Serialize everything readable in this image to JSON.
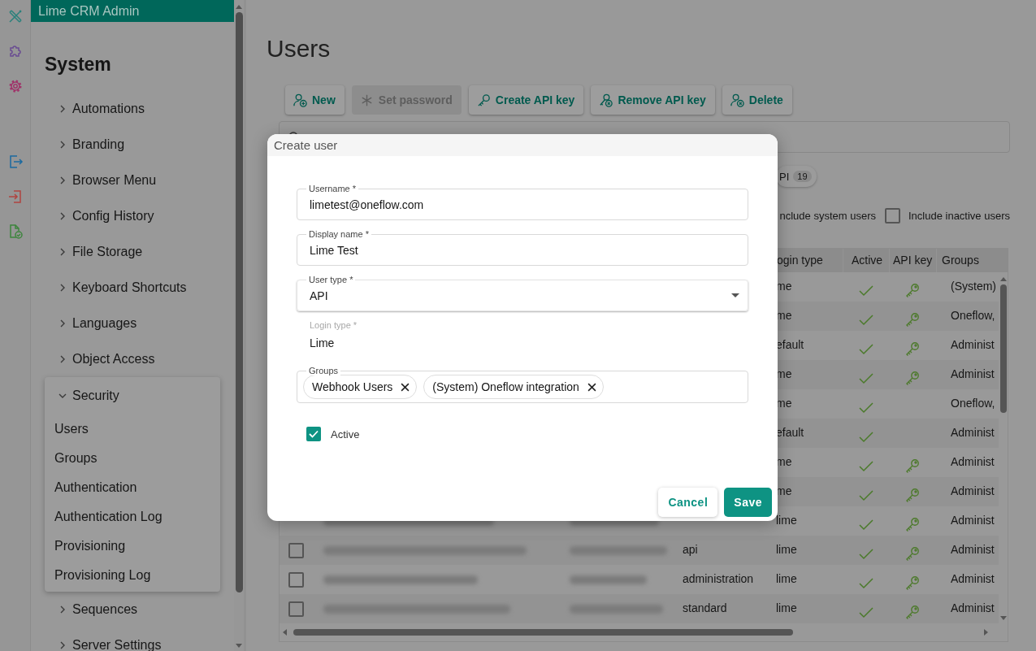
{
  "sidebar": {
    "header": "Lime CRM Admin",
    "section_title": "System",
    "items": [
      {
        "label": "Automations",
        "expanded": false
      },
      {
        "label": "Branding",
        "expanded": false
      },
      {
        "label": "Browser Menu",
        "expanded": false
      },
      {
        "label": "Config History",
        "expanded": false
      },
      {
        "label": "File Storage",
        "expanded": false
      },
      {
        "label": "Keyboard Shortcuts",
        "expanded": false
      },
      {
        "label": "Languages",
        "expanded": false
      },
      {
        "label": "Object Access",
        "expanded": false
      },
      {
        "label": "Security",
        "expanded": true,
        "children": [
          {
            "label": "Users"
          },
          {
            "label": "Groups"
          },
          {
            "label": "Authentication"
          },
          {
            "label": "Authentication Log"
          },
          {
            "label": "Provisioning"
          },
          {
            "label": "Provisioning Log"
          }
        ]
      },
      {
        "label": "Sequences",
        "expanded": false
      },
      {
        "label": "Server Settings",
        "expanded": false
      }
    ]
  },
  "page": {
    "title": "Users"
  },
  "toolbar": [
    {
      "label": "New",
      "kind": "new",
      "disabled": false
    },
    {
      "label": "Set password",
      "kind": "password",
      "disabled": true
    },
    {
      "label": "Create API key",
      "kind": "key",
      "disabled": false
    },
    {
      "label": "Remove API key",
      "kind": "remove-key",
      "disabled": false
    },
    {
      "label": "Delete",
      "kind": "delete",
      "disabled": false
    }
  ],
  "filter_chip": {
    "label": "PI",
    "count": "19"
  },
  "options": [
    {
      "label": "nclude system users"
    },
    {
      "label": "Include inactive users",
      "checked": false
    }
  ],
  "table": {
    "columns": [
      "ogin type",
      "Active",
      "API key",
      "Groups"
    ],
    "rows": [
      {
        "login_type": "me",
        "active": true,
        "api_key": true,
        "groups": "(System)"
      },
      {
        "login_type": "me",
        "active": true,
        "api_key": true,
        "groups": "Oneflow,"
      },
      {
        "login_type": "efault",
        "active": true,
        "api_key": true,
        "groups": "Administ"
      },
      {
        "login_type": "me",
        "active": true,
        "api_key": true,
        "groups": "Administ"
      },
      {
        "login_type": "me",
        "active": true,
        "api_key": false,
        "groups": "Oneflow,"
      },
      {
        "login_type": "efault",
        "active": true,
        "api_key": false,
        "groups": "Administ"
      },
      {
        "login_type": "me",
        "active": true,
        "api_key": true,
        "groups": "Administ"
      },
      {
        "login_type": "me",
        "active": true,
        "api_key": true,
        "groups": "Administ"
      },
      {
        "login_type": "lime",
        "active": true,
        "api_key": true,
        "groups": "Administ"
      },
      {
        "selected": false,
        "user_type": "api",
        "login_type": "lime",
        "active": true,
        "api_key": true,
        "groups": "Administ"
      },
      {
        "selected": false,
        "user_type": "administration",
        "login_type": "lime",
        "active": true,
        "api_key": true,
        "groups": "Administ"
      },
      {
        "selected": false,
        "user_type": "standard",
        "login_type": "lime",
        "active": true,
        "api_key": true,
        "groups": "Administ"
      }
    ]
  },
  "dialog": {
    "title": "Create user",
    "fields": [
      {
        "kind": "text",
        "label": "Username *",
        "value": "limetest@oneflow.com"
      },
      {
        "kind": "text",
        "label": "Display name *",
        "value": "Lime Test"
      },
      {
        "kind": "select",
        "label": "User type *",
        "value": "API"
      },
      {
        "kind": "readonly",
        "label": "Login type *",
        "value": "Lime"
      },
      {
        "kind": "chips",
        "label": "Groups",
        "chips": [
          "Webhook Users",
          "(System) Oneflow integration"
        ]
      }
    ],
    "active": {
      "label": "Active",
      "checked": true
    },
    "buttons": [
      {
        "label": "Cancel",
        "kind": "secondary"
      },
      {
        "label": "Save",
        "kind": "primary"
      }
    ]
  }
}
